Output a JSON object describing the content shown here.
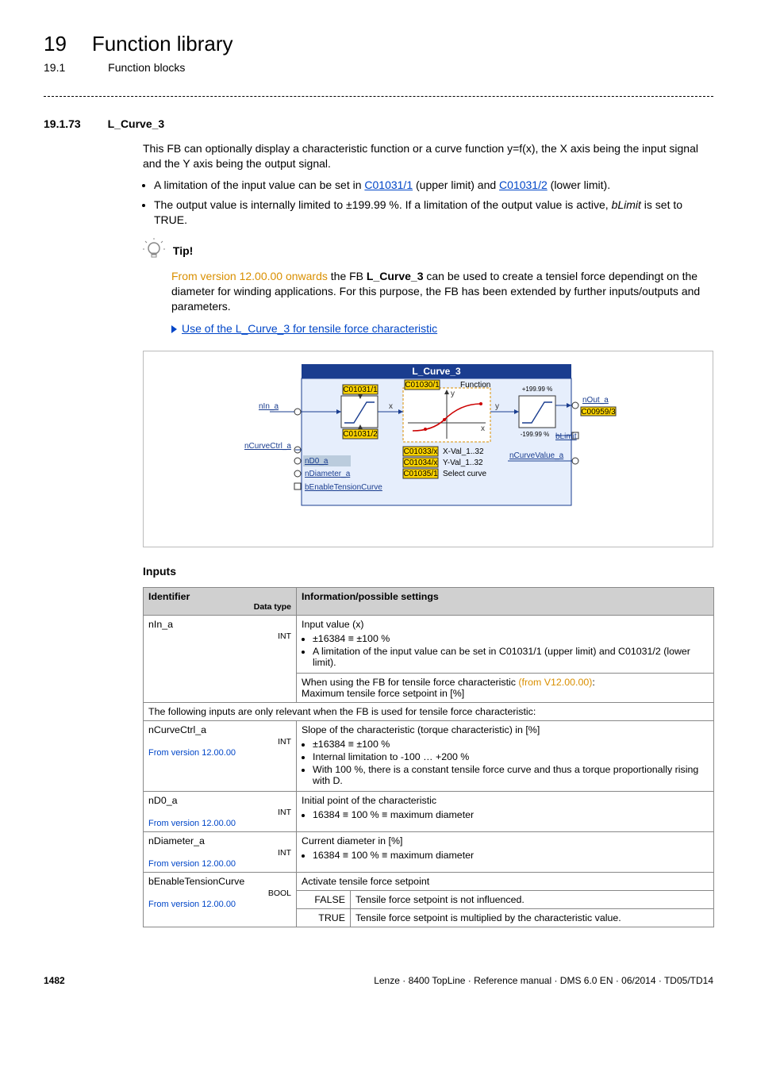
{
  "header": {
    "chapter_num": "19",
    "chapter_title": "Function library",
    "section_num": "19.1",
    "section_title": "Function blocks"
  },
  "subsection": {
    "num": "19.1.73",
    "title": "L_Curve_3"
  },
  "intro": {
    "para1": "This FB can optionally display a characteristic function or a curve function y=f(x), the X axis being the input signal and the Y axis being the output signal.",
    "bullet1_pre": "A limitation of the input value can be set in ",
    "bullet1_link1": "C01031/1",
    "bullet1_mid": " (upper limit) and ",
    "bullet1_link2": "C01031/2",
    "bullet1_post": " (lower limit).",
    "bullet2_a": "The output value is internally limited to ±199.99 %. If a limitation of the output value is active, ",
    "bullet2_i": "bLimit",
    "bullet2_b": " is set to TRUE."
  },
  "tip": {
    "label": "Tip!",
    "highlight": "From version 12.00.00 onwards",
    "body_a": " the FB ",
    "body_bold": "L_Curve_3",
    "body_b": " can be used to create a tensiel force dependingt on the diameter for winding applications. For this purpose, the FB has been extended by further inputs/outputs and parameters.",
    "link": "Use of the L_Curve_3 for tensile force characteristic"
  },
  "diagram": {
    "title": "L_Curve_3",
    "c01031_1": "C01031/1",
    "c01031_2": "C01031/2",
    "c01030_1": "C01030/1",
    "func": "Function",
    "c01033": "C01033/x",
    "xval": "X-Val_1..32",
    "c01034": "C01034/x",
    "yval": "Y-Val_1..32",
    "c01035": "C01035/1",
    "selcurve": "Select curve",
    "nIn_a": "nIn_a",
    "nCurveCtrl_a": "nCurveCtrl_a",
    "nD0_a": "nD0_a",
    "nDiameter_a": "nDiameter_a",
    "bEnable": "bEnableTensionCurve",
    "nOut_a": "nOut_a",
    "c00959_3": "C00959/3",
    "bLimit": "bLimit",
    "nCurveValue_a": "nCurveValue_a",
    "plus199": "+199.99 %",
    "minus199": "-199.99 %",
    "x": "x",
    "y": "y"
  },
  "inputs": {
    "heading": "Inputs",
    "th_id": "Identifier",
    "th_dt": "Data type",
    "th_info": "Information/possible settings",
    "row_nIn_a": {
      "id": "nIn_a",
      "dt": "INT",
      "line1": "Input value (x)",
      "b1": "±16384 ≡ ±100 %",
      "b2": "A limitation of the input value can be set in C01031/1 (upper limit) and C01031/2 (lower limit).",
      "line2_a": "When using the FB for tensile force characteristic ",
      "line2_hl": "(from V12.00.00)",
      "line2_b": ":",
      "line3": "Maximum tensile force setpoint in [%]"
    },
    "row_span": "The following inputs are only relevant when the FB is used for tensile force characteristic:",
    "row_nCurveCtrl": {
      "id": "nCurveCtrl_a",
      "ver": "From version 12.00.00",
      "dt": "INT",
      "line1": "Slope of the characteristic (torque characteristic) in [%]",
      "b1": "±16384 ≡ ±100 %",
      "b2": "Internal limitation to -100 … +200 %",
      "b3": "With 100 %, there is a constant tensile force curve and thus a torque proportionally rising with D."
    },
    "row_nD0": {
      "id": "nD0_a",
      "ver": "From version 12.00.00",
      "dt": "INT",
      "line1": "Initial point of the characteristic",
      "b1": "16384 ≡ 100 % ≡ maximum diameter"
    },
    "row_nDiameter": {
      "id": "nDiameter_a",
      "ver": "From version 12.00.00",
      "dt": "INT",
      "line1": "Current diameter in [%]",
      "b1": "16384 ≡ 100 % ≡ maximum diameter"
    },
    "row_bEnable": {
      "id": "bEnableTensionCurve",
      "ver": "From version 12.00.00",
      "dt": "BOOL",
      "line1": "Activate tensile force setpoint",
      "false_lbl": "FALSE",
      "false_txt": "Tensile force setpoint is not influenced.",
      "true_lbl": "TRUE",
      "true_txt": "Tensile force setpoint is multiplied by the characteristic value."
    }
  },
  "footer": {
    "page": "1482",
    "right": "Lenze · 8400 TopLine · Reference manual · DMS 6.0 EN · 06/2014 · TD05/TD14"
  }
}
